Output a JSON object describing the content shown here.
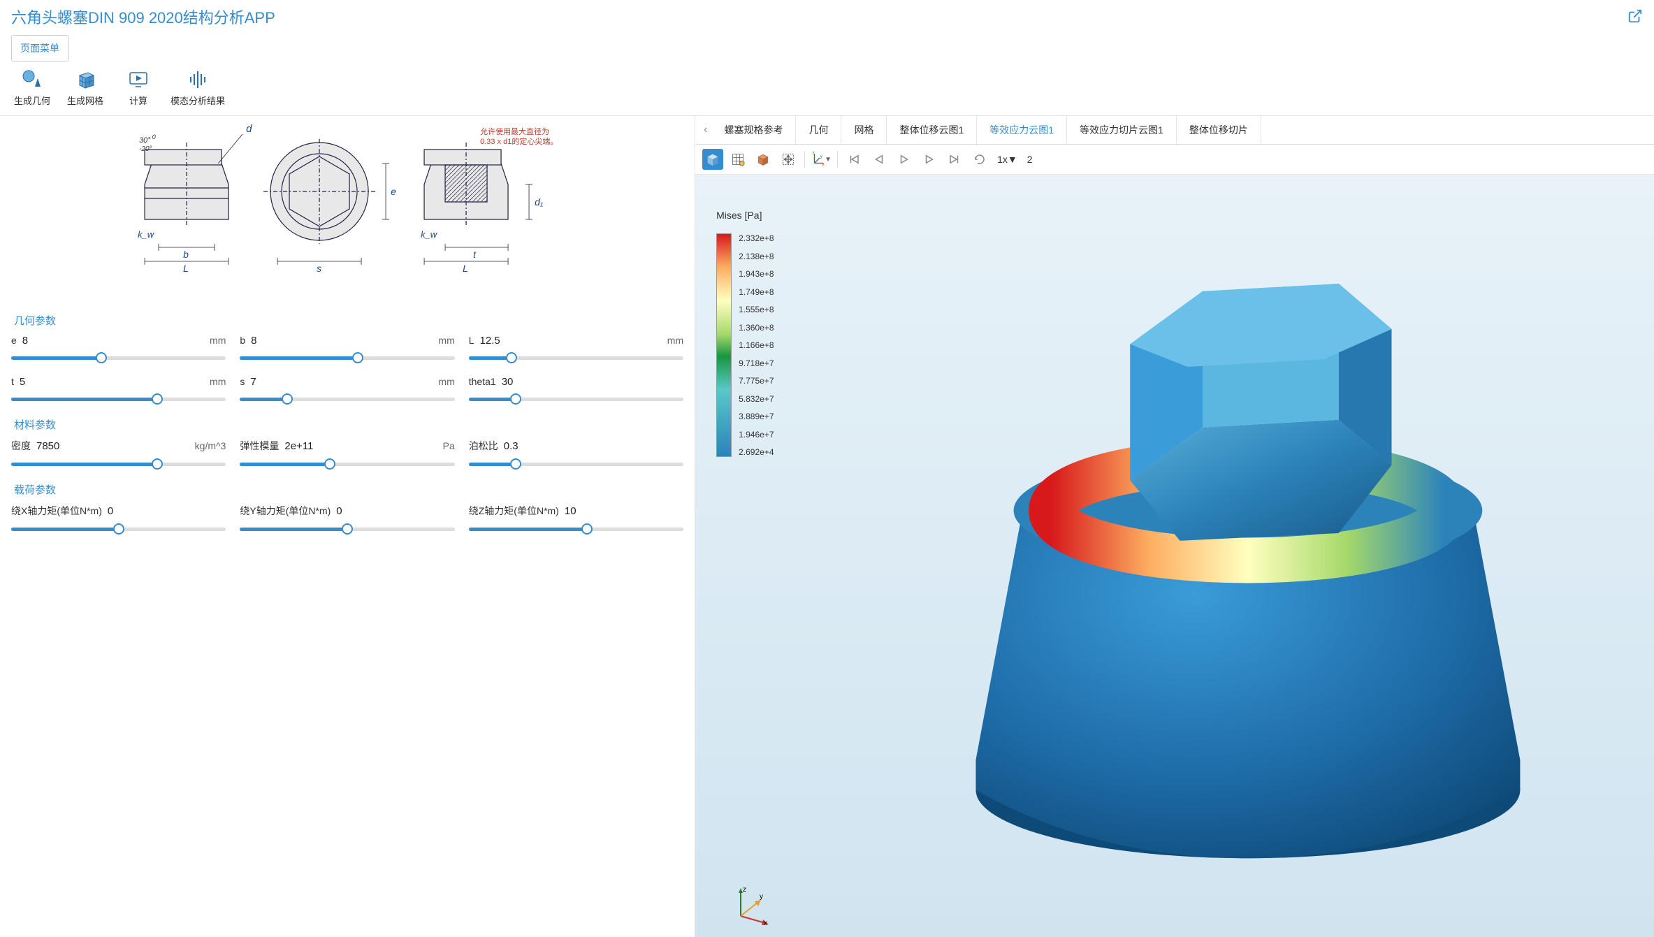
{
  "header": {
    "title": "六角头螺塞DIN 909 2020结构分析APP"
  },
  "menubar": {
    "item": "页面菜单"
  },
  "toolbar": {
    "generate_geometry": "生成几何",
    "generate_mesh": "生成网格",
    "compute": "计算",
    "modal_results": "模态分析结果"
  },
  "schematic": {
    "note_line1": "允许使用最大直径为",
    "note_line2": "0.33 x d1的定心尖端。",
    "angle1": "30°",
    "angle2": "-20°",
    "angle3": "0",
    "sym_d": "d",
    "sym_e": "e",
    "sym_d1": "d₁",
    "sym_kw": "k_w",
    "sym_b": "b",
    "sym_L": "L",
    "sym_s": "s",
    "sym_t": "t"
  },
  "sections": {
    "geometry": "几何参数",
    "material": "材料参数",
    "load": "载荷参数"
  },
  "geometry": {
    "e": {
      "label": "e",
      "value": "8",
      "unit": "mm",
      "pct": 42
    },
    "b": {
      "label": "b",
      "value": "8",
      "unit": "mm",
      "pct": 55
    },
    "L": {
      "label": "L",
      "value": "12.5",
      "unit": "mm",
      "pct": 20
    },
    "t": {
      "label": "t",
      "value": "5",
      "unit": "mm",
      "pct": 68
    },
    "s": {
      "label": "s",
      "value": "7",
      "unit": "mm",
      "pct": 22
    },
    "theta1": {
      "label": "theta1",
      "value": "30",
      "unit": "",
      "pct": 22
    }
  },
  "material": {
    "density": {
      "label": "密度",
      "value": "7850",
      "unit": "kg/m^3",
      "pct": 68
    },
    "young": {
      "label": "弹性模量",
      "value": "2e+11",
      "unit": "Pa",
      "pct": 42
    },
    "poisson": {
      "label": "泊松比",
      "value": "0.3",
      "unit": "",
      "pct": 22
    }
  },
  "load": {
    "mx": {
      "label": "绕X轴力矩(单位N*m)",
      "value": "0",
      "pct": 50
    },
    "my": {
      "label": "绕Y轴力矩(单位N*m)",
      "value": "0",
      "pct": 50
    },
    "mz": {
      "label": "绕Z轴力矩(单位N*m)",
      "value": "10",
      "pct": 55
    }
  },
  "tabs": {
    "spec": "螺塞规格参考",
    "geom": "几何",
    "mesh": "网格",
    "disp1": "整体位移云图1",
    "vm1": "等效应力云图1",
    "vmcut1": "等效应力切片云图1",
    "dispcut": "整体位移切片"
  },
  "viewer": {
    "frame_label": "1x▼",
    "frame_count": "2",
    "legend_title": "Mises [Pa]",
    "legend_values": [
      "2.332e+8",
      "2.138e+8",
      "1.943e+8",
      "1.749e+8",
      "1.555e+8",
      "1.360e+8",
      "1.166e+8",
      "9.718e+7",
      "7.775e+7",
      "5.832e+7",
      "3.889e+7",
      "1.946e+7",
      "2.692e+4"
    ],
    "axis_x": "x",
    "axis_y": "y",
    "axis_z": "z"
  }
}
